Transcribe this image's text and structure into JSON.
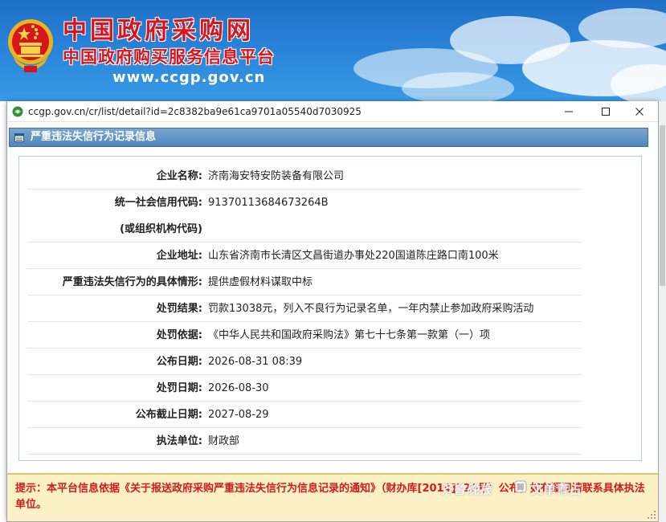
{
  "site": {
    "title_main": "中国政府采购网",
    "title_sub": "中国政府购买服务信息平台",
    "url": "www.ccgp.gov.cn"
  },
  "window": {
    "address": "ccgp.gov.cn/cr/list/detail?id=2c8382ba9e61ca9701a05540d7030925",
    "minimize": "—",
    "maximize": "☐",
    "close": "✕"
  },
  "section": {
    "title": "严重违法失信行为记录信息"
  },
  "record": {
    "rows": [
      {
        "label": "企业名称:",
        "value": "济南海安特安防装备有限公司"
      },
      {
        "label": "统一社会信用代码:",
        "value": "91370113684673264B"
      },
      {
        "label": "(或组织机构代码)",
        "value": ""
      },
      {
        "label": "企业地址:",
        "value": "山东省济南市长清区文昌街道办事处220国道陈庄路口南100米"
      },
      {
        "label": "严重违法失信行为的具体情形:",
        "value": "提供虚假材料谋取中标"
      },
      {
        "label": "处罚结果:",
        "value": "罚款13038元，列入不良行为记录名单，一年内禁止参加政府采购活动"
      },
      {
        "label": "处罚依据:",
        "value": "《中华人民共和国政府采购法》第七十七条第一款第（一）项"
      },
      {
        "label": "公布日期:",
        "value": "2026-08-31 08:39"
      },
      {
        "label": "处罚日期:",
        "value": "2026-08-30"
      },
      {
        "label": "公布截止日期:",
        "value": "2027-08-29"
      },
      {
        "label": "执法单位:",
        "value": "财政部"
      }
    ]
  },
  "notice": {
    "text": "提示：本平台信息依据《关于报送政府采购严重违法失信行为信息记录的通知》（财办库[2014]526号）公布，如有疑问请联系具体执法单位。"
  },
  "watermark": {
    "left": "齐鲁晚报",
    "right": "文单青占"
  },
  "colors": {
    "banner": "#2a86da",
    "title_red": "#d8141c",
    "section_bar": "#4f86bb",
    "notice_bg": "#fcf1c6",
    "notice_text": "#d11a1a"
  }
}
